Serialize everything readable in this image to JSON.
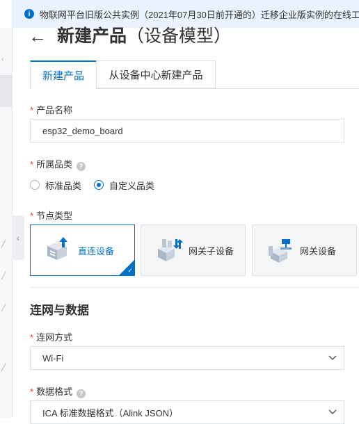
{
  "notice": {
    "icon": "info-icon",
    "text": "物联网平台旧版公共实例（2021年07月30日前开通的）迁移企业版实例的在线工"
  },
  "header": {
    "title": "新建产品",
    "title_paren": "（设备模型）"
  },
  "tabs": [
    {
      "label": "新建产品",
      "active": true
    },
    {
      "label": "从设备中心新建产品",
      "active": false
    }
  ],
  "form": {
    "product_name": {
      "label": "产品名称",
      "value": "esp32_demo_board"
    },
    "category": {
      "label": "所属品类",
      "options": [
        {
          "label": "标准品类",
          "checked": false
        },
        {
          "label": "自定义品类",
          "checked": true
        }
      ]
    },
    "node_type": {
      "label": "节点类型",
      "cards": [
        {
          "label": "直连设备",
          "icon": "direct-device-icon",
          "selected": true
        },
        {
          "label": "网关子设备",
          "icon": "sub-device-icon",
          "selected": false
        },
        {
          "label": "网关设备",
          "icon": "gateway-icon",
          "selected": false
        }
      ]
    },
    "network_section": {
      "title": "连网与数据"
    },
    "network_method": {
      "label": "连网方式",
      "value": "Wi-Fi"
    },
    "data_format": {
      "label": "数据格式",
      "value": "ICA 标准数据格式（Alink JSON）"
    }
  },
  "colors": {
    "primary": "#0070cc",
    "required": "#e23c39",
    "notice_bg": "#e8f3ff"
  }
}
